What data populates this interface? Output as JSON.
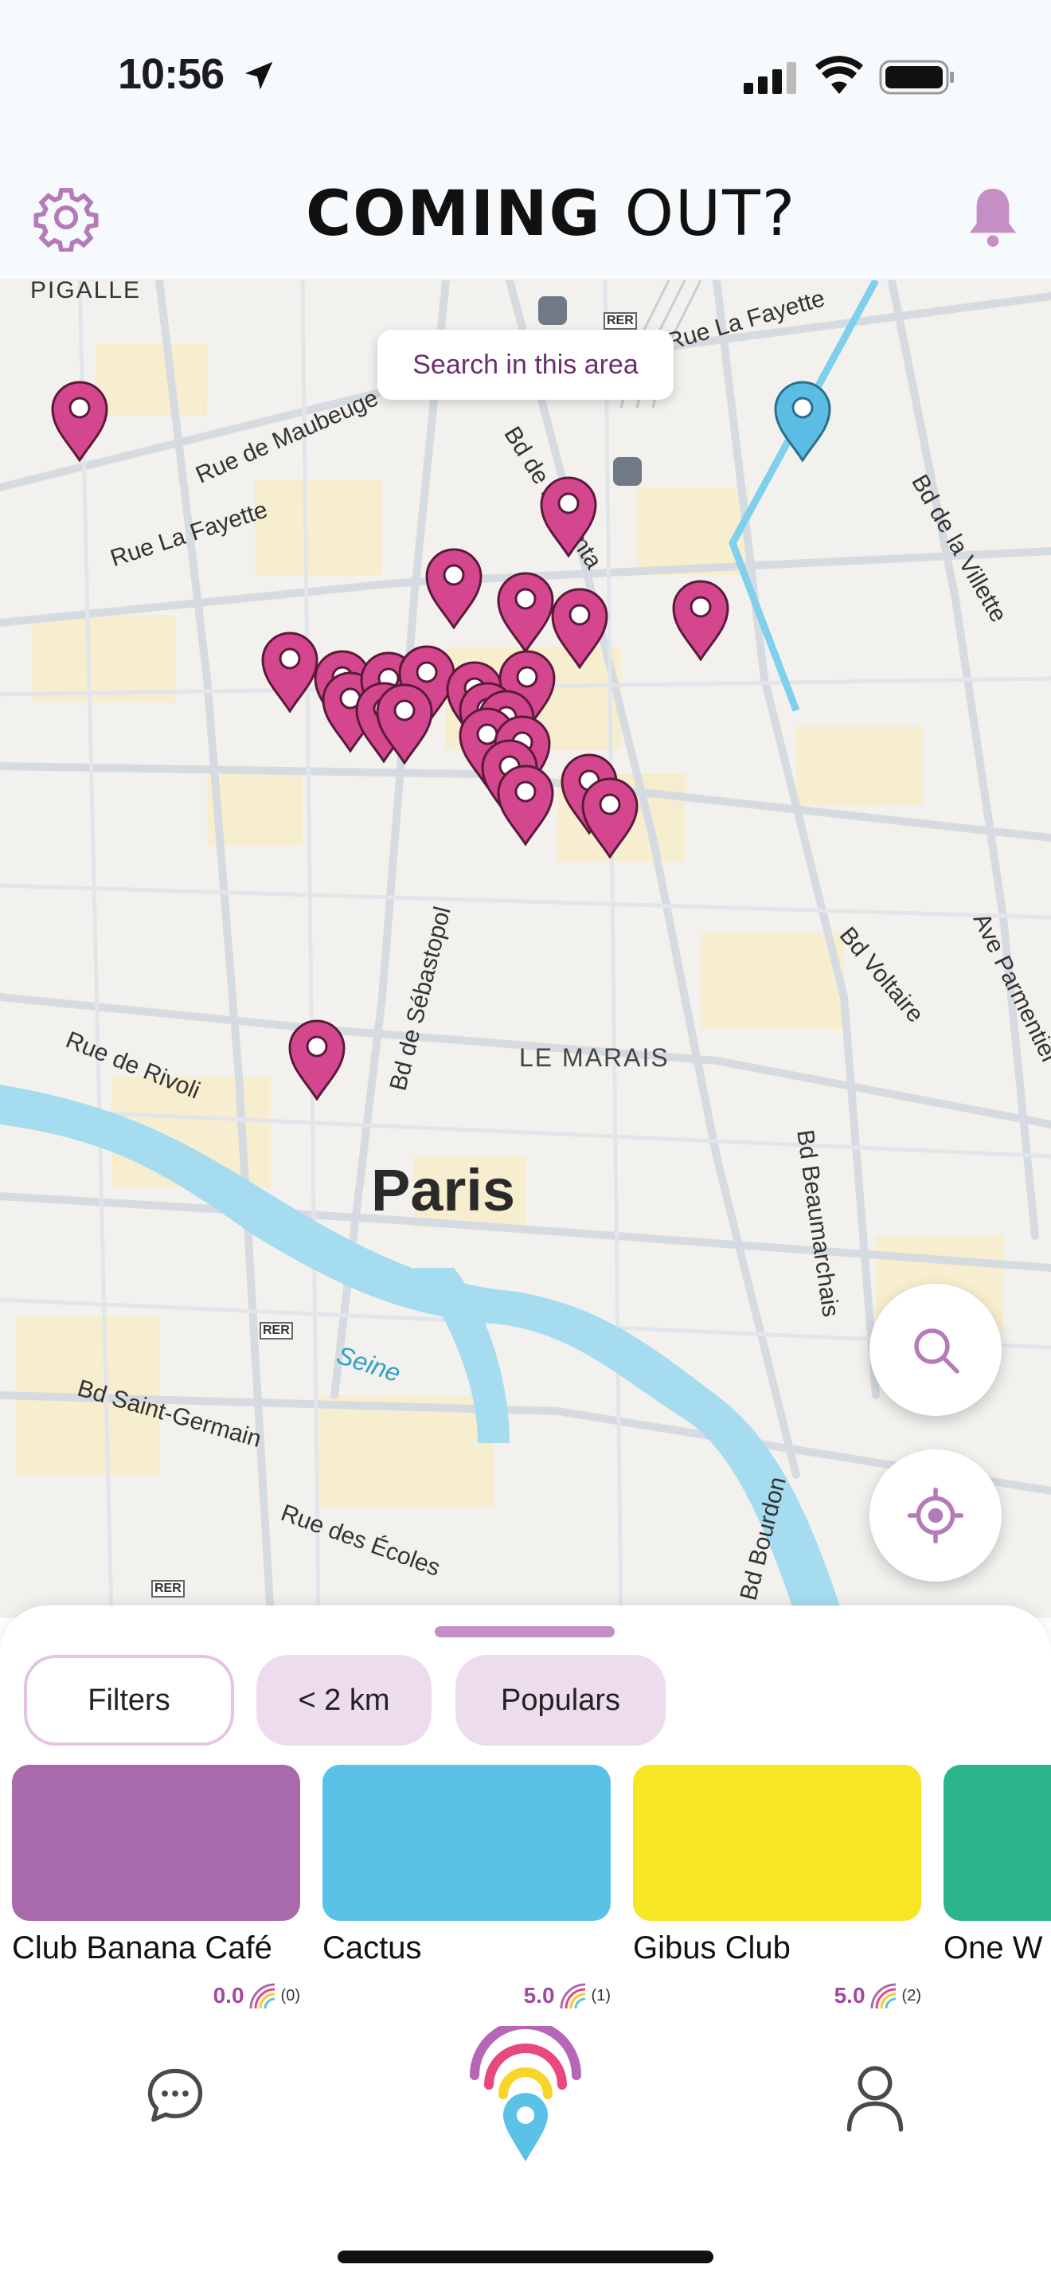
{
  "status_bar": {
    "time": "10:56"
  },
  "header": {
    "logo_coming": "COMING",
    "logo_out": "OUT?"
  },
  "map": {
    "search_area_label": "Search in this area",
    "labels": {
      "pigalle": "PIGALLE",
      "rue_la_fayette_top": "Rue La Fayette",
      "rue_de_maubeuge": "Rue de Maubeuge",
      "rue_la_fayette_left": "Rue La Fayette",
      "bd_de_magenta": "Bd de Magenta",
      "bd_de_la_villette": "Bd de la Villette",
      "bd_de_sebastopol": "Bd de Sébastopol",
      "bd_voltaire": "Bd Voltaire",
      "ave_parmentier": "Ave Parmentier",
      "rue_de_rivoli": "Rue de Rivoli",
      "le_marais": "LE MARAIS",
      "paris": "Paris",
      "bd_beaumarchais": "Bd Beaumarchais",
      "seine": "Seine",
      "bd_saint_germain": "Bd Saint-Germain",
      "rue_des_ecoles": "Rue des Écoles",
      "bd_bourdon": "Bd Bourdon",
      "rer_1": "RER",
      "rer_2": "RER",
      "rer_3": "RER"
    }
  },
  "sheet": {
    "filters_label": "Filters",
    "distance_label": "< 2 km",
    "populars_label": "Populars",
    "venues": [
      {
        "name": "Club Banana Café",
        "score": "0.0",
        "count": "(0)",
        "color": "#a86aaa"
      },
      {
        "name": "Cactus",
        "score": "5.0",
        "count": "(1)",
        "color": "#5bc2e7"
      },
      {
        "name": "Gibus Club",
        "score": "5.0",
        "count": "(2)",
        "color": "#f7e623"
      },
      {
        "name": "One W",
        "score": "",
        "count": "",
        "color": "#2bb58a"
      }
    ]
  },
  "colors": {
    "pin_magenta": "#d4478f",
    "pin_blue": "#5bbde3",
    "accent_purple": "#c58fc6"
  }
}
